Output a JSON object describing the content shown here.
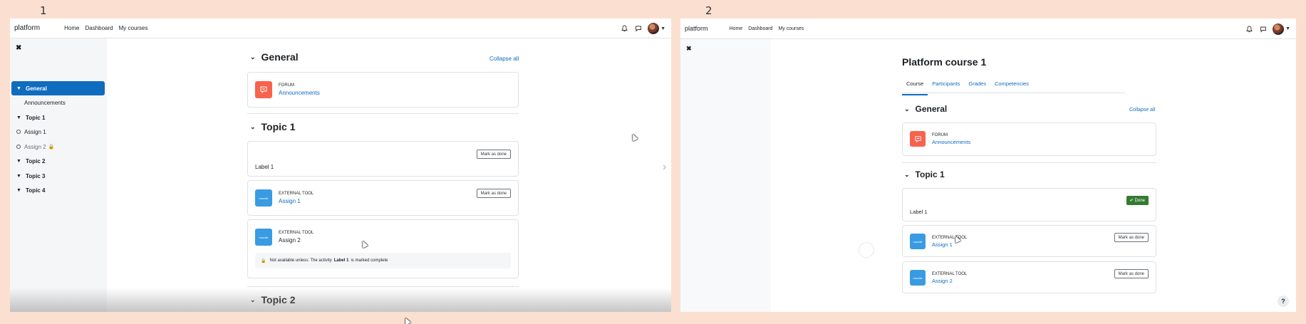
{
  "steps": [
    "1",
    "2"
  ],
  "navbar": {
    "brand": "platform",
    "links": [
      "Home",
      "Dashboard",
      "My courses"
    ]
  },
  "drawer": {
    "close_icon": "close-icon",
    "items": [
      {
        "label": "General",
        "type": "section",
        "active": true
      },
      {
        "label": "Announcements",
        "type": "activity"
      },
      {
        "label": "Topic 1",
        "type": "section"
      },
      {
        "label": "Assign 1",
        "type": "activity"
      },
      {
        "label": "Assign 2",
        "type": "activity",
        "locked": true
      },
      {
        "label": "Topic 2",
        "type": "section"
      },
      {
        "label": "Topic 3",
        "type": "section"
      },
      {
        "label": "Topic 4",
        "type": "section"
      }
    ]
  },
  "course": {
    "title": "Platform course 1",
    "tabs": [
      "Course",
      "Participants",
      "Grades",
      "Competencies"
    ],
    "collapse_all": "Collapse all",
    "sections": {
      "general": "General",
      "topic1": "Topic 1",
      "topic2": "Topic 2"
    },
    "forum": {
      "type": "FORUM",
      "name": "Announcements"
    },
    "label1": "Label 1",
    "assign1": {
      "type": "EXTERNAL TOOL",
      "name": "Assign 1"
    },
    "assign2": {
      "type": "EXTERNAL TOOL",
      "name": "Assign 2"
    },
    "mark_as_done": "Mark as done",
    "done": "Done",
    "restriction": {
      "prefix": "Not available unless: The activity",
      "activity": "Label 1",
      "suffix": "is marked complete"
    },
    "tool_icon_text": "moodle"
  },
  "help": "?",
  "colors": {
    "primary": "#0f6cbf",
    "forum": "#f7634d",
    "tool": "#399be2",
    "done": "#357a32",
    "background": "#fbe0d2"
  }
}
